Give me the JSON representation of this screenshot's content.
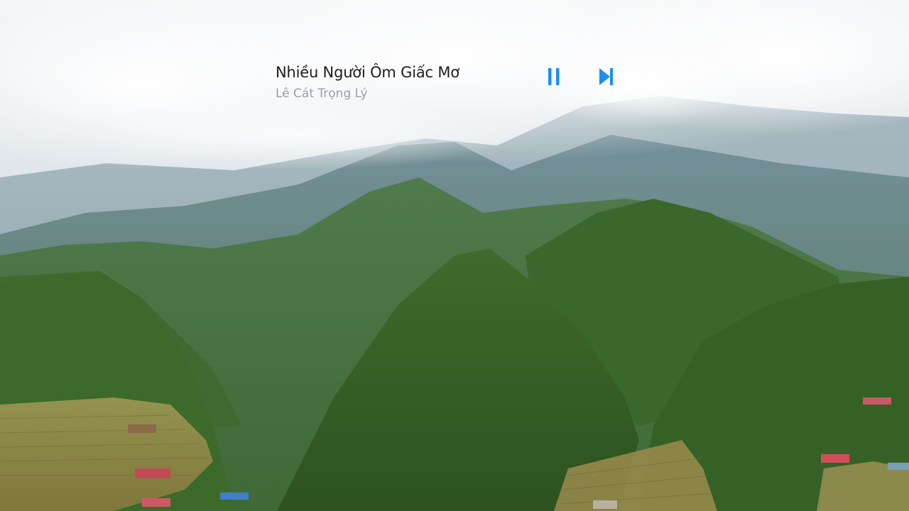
{
  "now_playing": {
    "title": "Nhiều Người Ôm Giấc Mơ",
    "artist": "Lê Cát Trọng Lý"
  },
  "controls": {
    "pause_icon": "pause-icon",
    "next_icon": "skip-next-icon"
  },
  "colors": {
    "accent": "#1a8ff0",
    "title": "#1d1d1f",
    "artist": "#9a9ea3"
  }
}
